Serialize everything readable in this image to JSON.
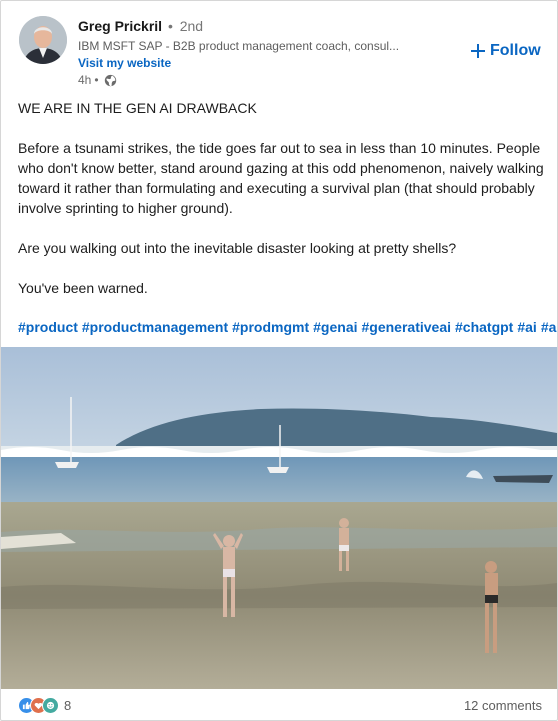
{
  "author": {
    "name": "Greg Prickril",
    "separator": "•",
    "degree": "2nd",
    "headline": "IBM MSFT SAP - B2B product management coach, consul...",
    "website_link": "Visit my website",
    "time": "4h",
    "visibility_icon": "globe-icon"
  },
  "follow_button": {
    "label": "Follow",
    "icon": "plus-icon"
  },
  "post": {
    "paragraphs": [
      "WE ARE IN THE GEN AI DRAWBACK",
      "Before a tsunami strikes, the tide goes far out to sea in less than 10 minutes. People who don't know better, stand around gazing at this odd phenomenon, naively walking toward it rather than formulating and executing a survival plan (that should probably involve sprinting to higher ground).",
      "Are you walking out into the inevitable disaster looking at pretty shells?",
      "You've been warned."
    ],
    "hashtags": [
      "#product",
      "#productmanagement",
      "#prodmgmt",
      "#genai",
      "#generativeai",
      "#chatgpt",
      "#ai",
      "#art"
    ]
  },
  "social": {
    "reaction_icons": [
      "like-icon",
      "love-icon",
      "funny-icon"
    ],
    "reaction_count": "8",
    "comments": "12 comments"
  },
  "colors": {
    "link": "#0a66c2",
    "muted": "#5e5e5e",
    "border": "#d6d6d6"
  }
}
